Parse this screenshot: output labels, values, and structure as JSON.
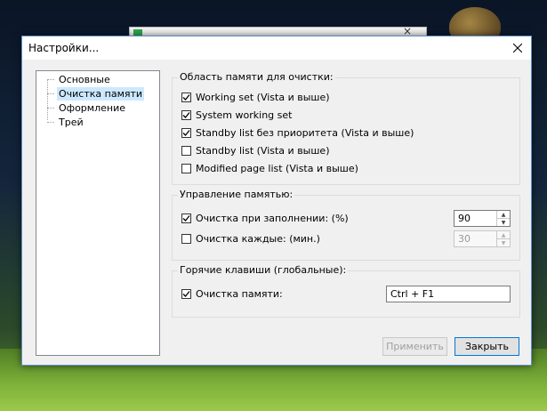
{
  "dialog": {
    "title": "Настройки..."
  },
  "tree": {
    "items": [
      {
        "label": "Основные",
        "selected": false
      },
      {
        "label": "Очистка памяти",
        "selected": true
      },
      {
        "label": "Оформление",
        "selected": false
      },
      {
        "label": "Трей",
        "selected": false
      }
    ]
  },
  "memory_area": {
    "title": "Область памяти для очистки:",
    "options": [
      {
        "label": "Working set (Vista и выше)",
        "checked": true
      },
      {
        "label": "System working set",
        "checked": true
      },
      {
        "label": "Standby list без приоритета (Vista и выше)",
        "checked": true
      },
      {
        "label": "Standby list (Vista и выше)",
        "checked": false
      },
      {
        "label": "Modified page list (Vista и выше)",
        "checked": false
      }
    ]
  },
  "memory_management": {
    "title": "Управление памятью:",
    "fill_cleanup": {
      "label": "Очистка при заполнении: (%)",
      "checked": true,
      "value": "90"
    },
    "interval_cleanup": {
      "label": "Очистка каждые: (мин.)",
      "checked": false,
      "value": "30"
    }
  },
  "hotkeys": {
    "title": "Горячие клавиши (глобальные):",
    "clean_memory": {
      "label": "Очистка памяти:",
      "checked": true,
      "value": "Ctrl + F1"
    }
  },
  "buttons": {
    "apply": "Применить",
    "close": "Закрыть"
  },
  "colors": {
    "accent": "#0078d7",
    "selection": "#cce8ff",
    "dialog_bg": "#f0f0f0"
  }
}
